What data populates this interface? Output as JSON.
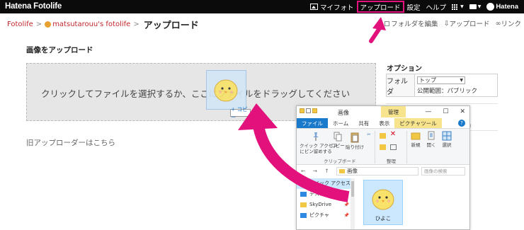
{
  "topbar": {
    "logo": "Hatena Fotolife",
    "nav": [
      {
        "label": "マイフォト"
      },
      {
        "label": "アップロード"
      },
      {
        "label": "設定"
      },
      {
        "label": "ヘルプ"
      }
    ],
    "brand": "Hatena",
    "accent_color": "#e2117c"
  },
  "breadcrumb": {
    "root": "Fotolife",
    "user": "matsutarouu's fotolife",
    "current": "アップロード",
    "separator": ">"
  },
  "actions": {
    "edit_folders": "フォルダを編集",
    "upload": "アップロード",
    "link": "リンク"
  },
  "upload": {
    "section_title": "画像をアップロード",
    "drop_text": "クリックしてファイルを選択するか、ここにファイルをドラッグしてください",
    "copy_badge": "+ コピー",
    "old_uploader": "旧アップローダーはこちら"
  },
  "options": {
    "title": "オプション",
    "folder_label": "フォルダ",
    "folder_value": "トップ",
    "scope": "公開範囲：パブリック",
    "size_hint": "KB）"
  },
  "explorer": {
    "title": "画像",
    "manage_tab": "管理",
    "window_controls": [
      "—",
      "☐",
      "✕"
    ],
    "tabs": [
      "ファイル",
      "ホーム",
      "共有",
      "表示",
      "ピクチャツール"
    ],
    "help": "?",
    "ribbon": {
      "pin": "クイック アクセス\nにピン留めする",
      "copy": "コピー",
      "paste": "貼り付け",
      "clipboard_group": "クリップボード",
      "organize_group": "整理",
      "new": "新規",
      "open": "開く",
      "select": "選択"
    },
    "address": {
      "arrows": "← → ↑",
      "path": "画像",
      "search_placeholder": "画像の検索"
    },
    "nav_items": [
      {
        "label": "クイック アクセス"
      },
      {
        "label": "デスクトップ"
      },
      {
        "label": "SkyDrive"
      },
      {
        "label": "ピクチャ"
      }
    ],
    "file_name": "ひよこ"
  }
}
